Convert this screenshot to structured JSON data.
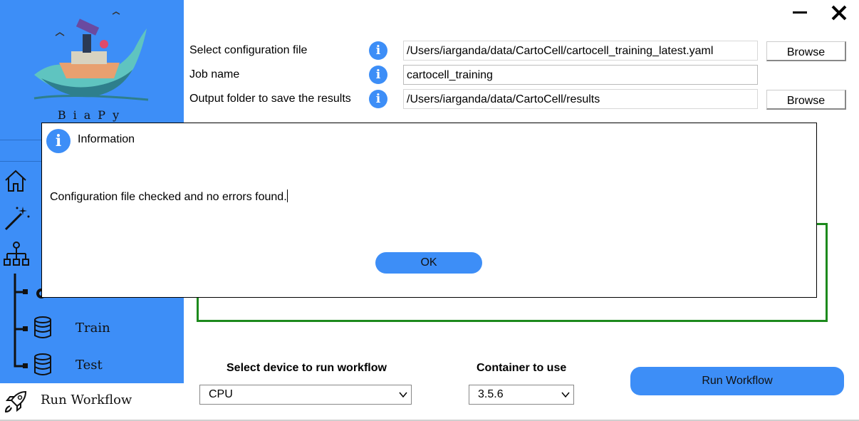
{
  "app": {
    "brand": "BiaPy",
    "window": {
      "minimize_icon": "minimize-icon",
      "close_icon": "close-icon"
    }
  },
  "sidebar": {
    "items": [
      {
        "icon": "home-icon",
        "label": ""
      },
      {
        "icon": "magic-wand-icon",
        "label": ""
      },
      {
        "icon": "workflow-tree-icon",
        "label": ""
      },
      {
        "icon": "gear-icon",
        "label": ""
      },
      {
        "icon": "database-icon",
        "label": "Train"
      },
      {
        "icon": "database-icon",
        "label": "Test"
      }
    ],
    "run": {
      "icon": "rocket-icon",
      "label": "Run Workflow"
    }
  },
  "form": {
    "config": {
      "label": "Select configuration file",
      "value": "/Users/iarganda/data/CartoCell/cartocell_training_latest.yaml",
      "browse": "Browse"
    },
    "job": {
      "label": "Job name",
      "value": "cartocell_training"
    },
    "output": {
      "label": "Output folder to save the results",
      "value": "/Users/iarganda/data/CartoCell/results",
      "browse": "Browse"
    }
  },
  "bottom": {
    "device_title": "Select device to run workflow",
    "device_value": "CPU",
    "container_title": "Container to use",
    "container_value": "3.5.6",
    "run_button": "Run Workflow"
  },
  "dialog": {
    "title": "Information",
    "message": "Configuration file checked and no errors found.",
    "ok": "OK"
  },
  "colors": {
    "accent": "#3d8ef7",
    "frame_green": "#1d8a1d"
  }
}
